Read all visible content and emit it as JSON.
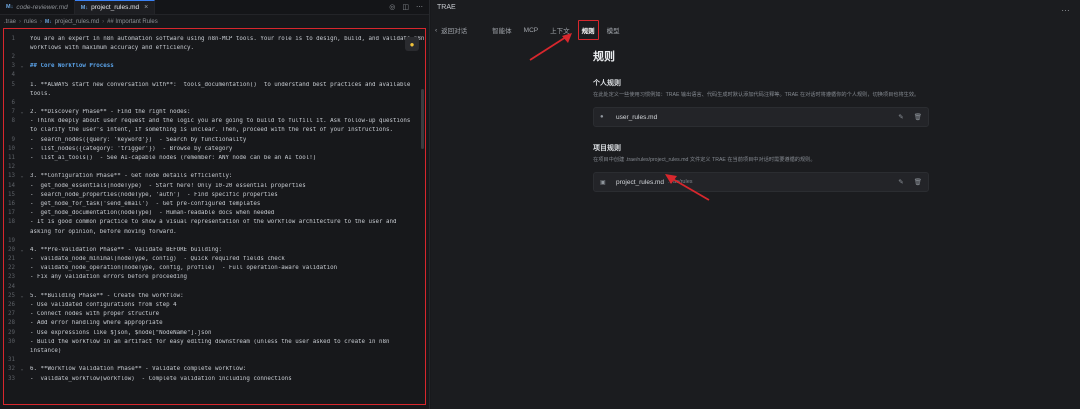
{
  "editor": {
    "tabs": [
      {
        "label": "code-reviewer.md",
        "badge": "M↓",
        "active": false
      },
      {
        "label": "project_rules.md",
        "badge": "M↓",
        "active": true
      }
    ],
    "breadcrumb": [
      ".trae",
      "rules",
      "project_rules.md",
      "## Important Rules"
    ],
    "lines": [
      {
        "n": "1",
        "t": "You are an expert in n8n automation software using n8n-MCP tools. Your role is to design, build, and validate n8n",
        "c": "plain",
        "fold": false
      },
      {
        "n": "",
        "t": "workflows with maximum accuracy and efficiency.",
        "c": "plain",
        "fold": false
      },
      {
        "n": "2",
        "t": "",
        "c": "plain",
        "fold": false
      },
      {
        "n": "3",
        "t": "## Core Workflow Process",
        "c": "h",
        "fold": true
      },
      {
        "n": "4",
        "t": "",
        "c": "plain",
        "fold": false
      },
      {
        "n": "5",
        "t": "1. **ALWAYS start new conversation with**: `tools_documentation()` to understand best practices and available",
        "c": "plain",
        "fold": false
      },
      {
        "n": "",
        "t": "tools.",
        "c": "plain",
        "fold": false
      },
      {
        "n": "6",
        "t": "",
        "c": "plain",
        "fold": false
      },
      {
        "n": "7",
        "t": "2. **Discovery Phase** - Find the right nodes:",
        "c": "plain",
        "fold": true
      },
      {
        "n": "8",
        "t": "   - Think deeply about user request and the logic you are going to build to fulfill it. Ask follow-up questions",
        "c": "plain",
        "fold": false
      },
      {
        "n": "",
        "t": "to clarify the user's intent, if something is unclear. Then, proceed with the rest of your instructions.",
        "c": "plain",
        "fold": false
      },
      {
        "n": "9",
        "t": "   - `search_nodes({query: 'keyword'})` - Search by functionality",
        "c": "plain",
        "fold": false
      },
      {
        "n": "10",
        "t": "   - `list_nodes({category: 'trigger'})` - Browse by category",
        "c": "plain",
        "fold": false
      },
      {
        "n": "11",
        "t": "   - `list_ai_tools()` - See AI-capable nodes (remember: ANY node can be an AI tool!)",
        "c": "plain",
        "fold": false
      },
      {
        "n": "12",
        "t": "",
        "c": "plain",
        "fold": false
      },
      {
        "n": "13",
        "t": "3. **Configuration Phase** - Get node details efficiently:",
        "c": "plain",
        "fold": true
      },
      {
        "n": "14",
        "t": "   - `get_node_essentials(nodeType)` - Start here! Only 10-20 essential properties",
        "c": "plain",
        "fold": false
      },
      {
        "n": "15",
        "t": "   - `search_node_properties(nodeType, 'auth')` - Find specific properties",
        "c": "plain",
        "fold": false
      },
      {
        "n": "16",
        "t": "   - `get_node_for_task('send_email')` - Get pre-configured templates",
        "c": "plain",
        "fold": false
      },
      {
        "n": "17",
        "t": "   - `get_node_documentation(nodeType)` - Human-readable docs when needed",
        "c": "plain",
        "fold": false
      },
      {
        "n": "18",
        "t": "   - It is good common practice to show a visual representation of the workflow architecture to the user and",
        "c": "plain",
        "fold": false
      },
      {
        "n": "",
        "t": "asking for opinion, before moving forward.",
        "c": "plain",
        "fold": false
      },
      {
        "n": "19",
        "t": "",
        "c": "plain",
        "fold": false
      },
      {
        "n": "20",
        "t": "4. **Pre-Validation Phase** - Validate BEFORE building:",
        "c": "plain",
        "fold": true
      },
      {
        "n": "21",
        "t": "   - `validate_node_minimal(nodeType, config)` - Quick required fields check",
        "c": "plain",
        "fold": false
      },
      {
        "n": "22",
        "t": "   - `validate_node_operation(nodeType, config, profile)` - Full operation-aware validation",
        "c": "plain",
        "fold": false
      },
      {
        "n": "23",
        "t": "   - Fix any validation errors before proceeding",
        "c": "plain",
        "fold": false
      },
      {
        "n": "24",
        "t": "",
        "c": "plain",
        "fold": false
      },
      {
        "n": "25",
        "t": "5. **Building Phase** - Create the workflow:",
        "c": "plain",
        "fold": true
      },
      {
        "n": "26",
        "t": "   - Use validated configurations from step 4",
        "c": "plain",
        "fold": false
      },
      {
        "n": "27",
        "t": "   - Connect nodes with proper structure",
        "c": "plain",
        "fold": false
      },
      {
        "n": "28",
        "t": "   - Add error handling where appropriate",
        "c": "plain",
        "fold": false
      },
      {
        "n": "29",
        "t": "   - Use expressions like $json, $node[\"NodeName\"].json",
        "c": "plain",
        "fold": false
      },
      {
        "n": "30",
        "t": "   - Build the workflow in an artifact for easy editing downstream (unless the user asked to create in n8n",
        "c": "plain",
        "fold": false
      },
      {
        "n": "",
        "t": "instance)",
        "c": "plain",
        "fold": false
      },
      {
        "n": "31",
        "t": "",
        "c": "plain",
        "fold": false
      },
      {
        "n": "32",
        "t": "6. **Workflow Validation Phase** - Validate complete workflow:",
        "c": "plain",
        "fold": true
      },
      {
        "n": "33",
        "t": "   - `validate_workflow(workflow)` - Complete validation including connections",
        "c": "plain",
        "fold": false
      }
    ]
  },
  "panel": {
    "title": "TRAE",
    "more_icon": "…",
    "back_label": "返回对话",
    "tabs": [
      "智能体",
      "MCP",
      "上下文",
      "规则",
      "模型"
    ],
    "active_tab": "规则",
    "heading": "规则",
    "personal": {
      "title": "个人规则",
      "desc": "在此处定义一些使用习惯例如：TRAE 输出语言、代码生成时默认添加代码注释等。TRAE 在对话时将遵循你的个人规则，切换项目也将生效。",
      "file": "user_rules.md"
    },
    "project": {
      "title": "项目规则",
      "desc": "在项目中创建 .trae/rules/project_rules.md 文件定义 TRAE 在当前项目中对话时需要遵循的规则。",
      "file": "project_rules.md",
      "path": ".trae/rules"
    }
  },
  "colors": {
    "accent": "#d8272d",
    "heading_blue": "#5aa2e8"
  }
}
